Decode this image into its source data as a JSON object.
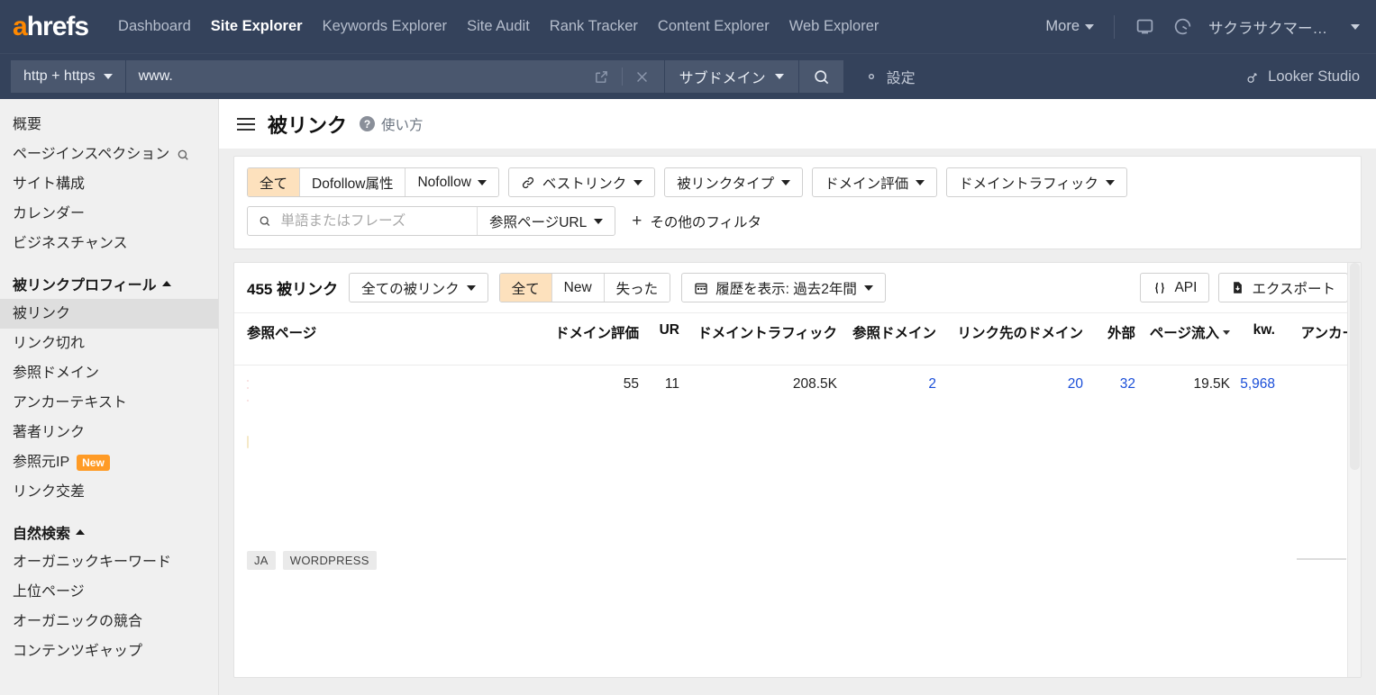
{
  "topnav": {
    "logo": "ahrefs",
    "links": [
      {
        "label": "Dashboard",
        "active": false
      },
      {
        "label": "Site Explorer",
        "active": true
      },
      {
        "label": "Keywords Explorer",
        "active": false
      },
      {
        "label": "Site Audit",
        "active": false
      },
      {
        "label": "Rank Tracker",
        "active": false
      },
      {
        "label": "Content Explorer",
        "active": false
      },
      {
        "label": "Web Explorer",
        "active": false
      }
    ],
    "more_label": "More",
    "screen_icon": "monitor-icon",
    "usage_icon": "gauge-icon",
    "user_name": "サクラサクマー…"
  },
  "searchbar": {
    "protocol": "http + https",
    "url_value": "www.",
    "open_external_icon": "external-link-icon",
    "clear_icon": "close-icon",
    "scope": "サブドメイン",
    "search_icon": "search-icon",
    "settings_icon": "gear-icon",
    "settings_label": "設定",
    "looker_icon": "looker-studio-icon",
    "looker_label": "Looker Studio"
  },
  "sidebar": {
    "items_top": [
      {
        "label": "概要",
        "icon": null
      },
      {
        "label": "ページインスペクション",
        "icon": "search-icon"
      },
      {
        "label": "サイト構成",
        "icon": null
      },
      {
        "label": "カレンダー",
        "icon": null
      },
      {
        "label": "ビジネスチャンス",
        "icon": null
      }
    ],
    "group_backlinks": {
      "label": "被リンクプロフィール",
      "expanded": true,
      "items": [
        {
          "label": "被リンク",
          "selected": true,
          "badge": null
        },
        {
          "label": "リンク切れ",
          "selected": false,
          "badge": null
        },
        {
          "label": "参照ドメイン",
          "selected": false,
          "badge": null
        },
        {
          "label": "アンカーテキスト",
          "selected": false,
          "badge": null
        },
        {
          "label": "著者リンク",
          "selected": false,
          "badge": null
        },
        {
          "label": "参照元IP",
          "selected": false,
          "badge": "New"
        },
        {
          "label": "リンク交差",
          "selected": false,
          "badge": null
        }
      ]
    },
    "group_organic": {
      "label": "自然検索",
      "expanded": true,
      "items": [
        {
          "label": "オーガニックキーワード"
        },
        {
          "label": "上位ページ"
        },
        {
          "label": "オーガニックの競合"
        },
        {
          "label": "コンテンツギャップ"
        }
      ]
    }
  },
  "page": {
    "menu_icon": "hamburger-icon",
    "title": "被リンク",
    "help_icon": "question-mark-icon",
    "help_label": "使い方"
  },
  "filters": {
    "follow_segment": [
      {
        "label": "全て",
        "active": true
      },
      {
        "label": "Dofollow属性",
        "active": false
      }
    ],
    "nofollow": {
      "label": "Nofollow"
    },
    "best_links": {
      "label": "ベストリンク",
      "icon": "link-icon"
    },
    "backlink_type": {
      "label": "被リンクタイプ"
    },
    "domain_rating": {
      "label": "ドメイン評価"
    },
    "domain_traffic": {
      "label": "ドメイントラフィック"
    },
    "search": {
      "icon": "search-icon",
      "placeholder": "単語またはフレーズ",
      "value": "",
      "scope": "参照ページURL"
    },
    "more_filters": {
      "icon": "plus-icon",
      "label": "その他のフィルタ"
    }
  },
  "toolbar": {
    "count": "455 被リンク",
    "link_mode": "全ての被リンク",
    "state_segment": [
      {
        "label": "全て",
        "active": true
      },
      {
        "label": "New",
        "active": false
      },
      {
        "label": "失った",
        "active": false
      }
    ],
    "history": {
      "icon": "calendar-icon",
      "label": "履歴を表示: 過去2年間"
    },
    "api": {
      "icon": "braces-icon",
      "label": "API"
    },
    "export": {
      "icon": "download-file-icon",
      "label": "エクスポート"
    }
  },
  "table": {
    "columns": [
      {
        "key": "ref",
        "label": "参照ページ",
        "align": "left",
        "sorted": false
      },
      {
        "key": "dr",
        "label": "ドメイン評価",
        "align": "right",
        "sorted": false
      },
      {
        "key": "ur",
        "label": "UR",
        "align": "right",
        "sorted": false
      },
      {
        "key": "dt",
        "label": "ドメイントラフィック",
        "align": "right",
        "sorted": false
      },
      {
        "key": "rd",
        "label": "参照ドメイン",
        "align": "right",
        "sorted": false
      },
      {
        "key": "ld",
        "label": "リンク先のドメイン",
        "align": "right",
        "sorted": false
      },
      {
        "key": "ext",
        "label": "外部",
        "align": "right",
        "sorted": false
      },
      {
        "key": "pt",
        "label": "ページ流入",
        "align": "right",
        "sorted": true
      },
      {
        "key": "kw",
        "label": "kw.",
        "align": "right",
        "sorted": false
      },
      {
        "key": "an",
        "label": "アンカー",
        "align": "right",
        "sorted": false
      }
    ],
    "rows": [
      {
        "ref_page": "",
        "dr": "55",
        "ur": "11",
        "dt": "208.5K",
        "rd": "2",
        "ld": "20",
        "ext": "32",
        "pt": "19.5K",
        "kw": "5,968",
        "an": "",
        "tags": [
          "JA",
          "WORDPRESS"
        ]
      }
    ]
  },
  "colors": {
    "nav_bg": "#34425b",
    "accent_orange": "#ff8800",
    "highlight": "#fde1bd",
    "link_blue": "#1a4ed8",
    "sidebar_bg": "#f0f0f0",
    "canvas_bg": "#eeeeee"
  }
}
